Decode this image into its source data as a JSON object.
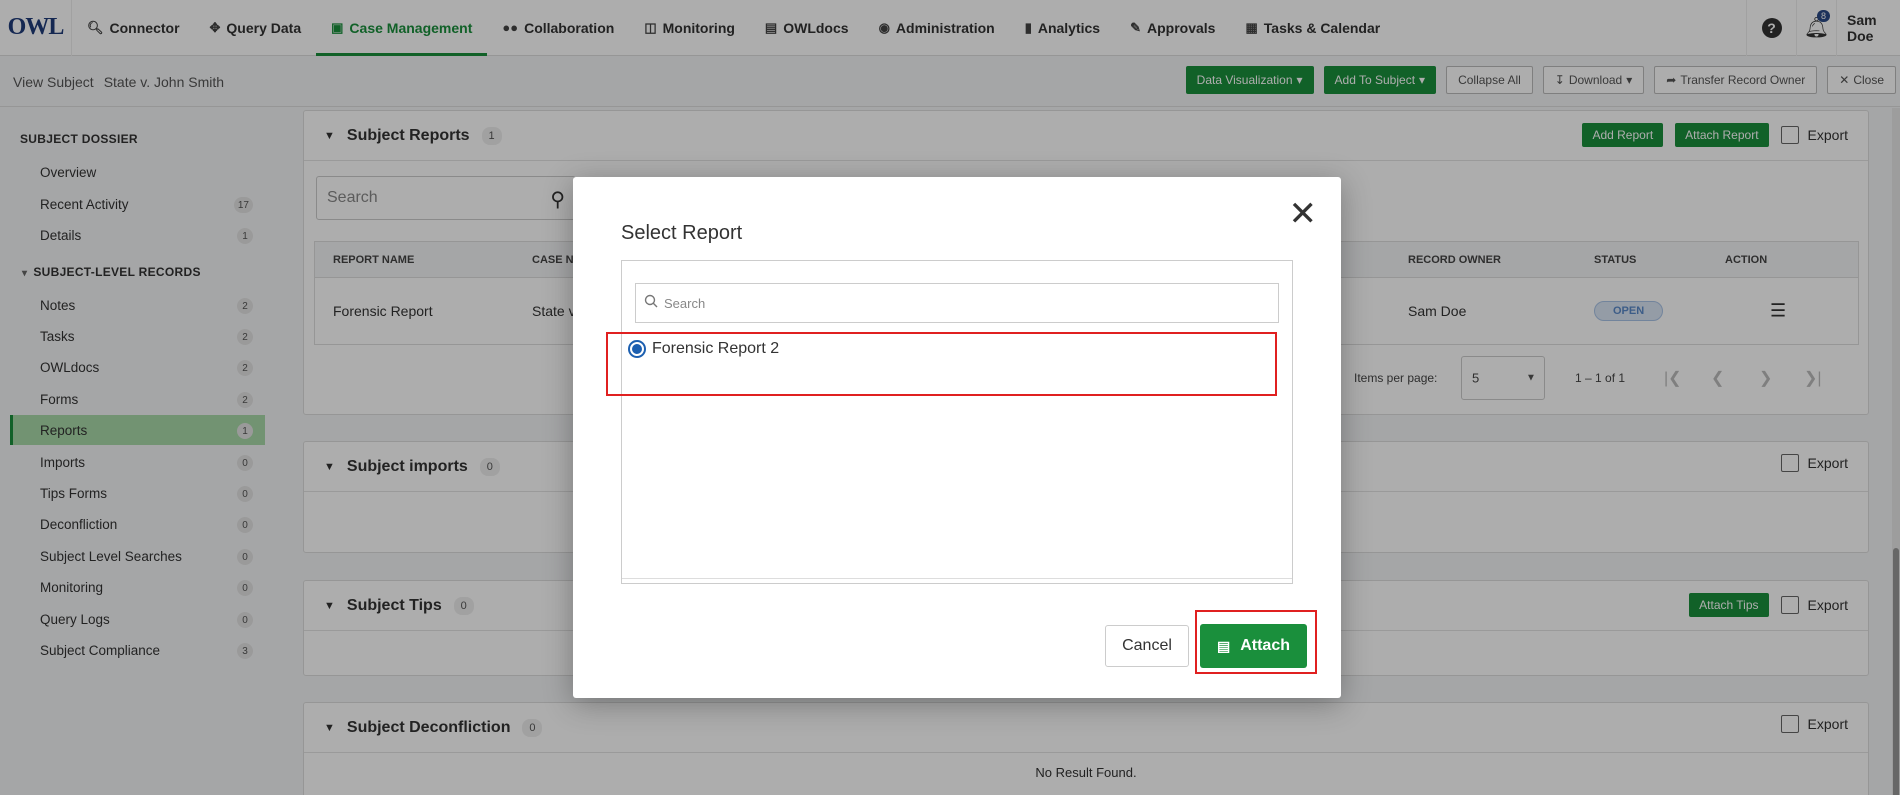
{
  "logo": {
    "text": "OWL"
  },
  "nav": {
    "items": [
      {
        "label": "Connector",
        "icon": "search-icon"
      },
      {
        "label": "Query Data",
        "icon": "move-icon"
      },
      {
        "label": "Case Management",
        "icon": "briefcase-icon",
        "active": true
      },
      {
        "label": "Collaboration",
        "icon": "users-icon"
      },
      {
        "label": "Monitoring",
        "icon": "monitor-icon"
      },
      {
        "label": "OWLdocs",
        "icon": "docs-icon"
      },
      {
        "label": "Administration",
        "icon": "admin-icon"
      },
      {
        "label": "Analytics",
        "icon": "chart-icon"
      },
      {
        "label": "Approvals",
        "icon": "approval-icon"
      },
      {
        "label": "Tasks & Calendar",
        "icon": "calendar-icon"
      }
    ],
    "notifications": "8",
    "user": "Sam Doe"
  },
  "subheader": {
    "label": "View Subject",
    "subject": "State v. John Smith",
    "actions": {
      "data_viz": "Data Visualization",
      "add_to_subject": "Add To Subject",
      "collapse_all": "Collapse All",
      "download": "Download",
      "transfer": "Transfer Record Owner",
      "close": "Close"
    }
  },
  "sidebar": {
    "heading": "SUBJECT DOSSIER",
    "top_items": [
      {
        "label": "Overview",
        "count": null
      },
      {
        "label": "Recent Activity",
        "count": "17"
      },
      {
        "label": "Details",
        "count": "1"
      }
    ],
    "section": "SUBJECT-LEVEL RECORDS",
    "items": [
      {
        "label": "Notes",
        "count": "2"
      },
      {
        "label": "Tasks",
        "count": "2"
      },
      {
        "label": "OWLdocs",
        "count": "2"
      },
      {
        "label": "Forms",
        "count": "2"
      },
      {
        "label": "Reports",
        "count": "1",
        "active": true
      },
      {
        "label": "Imports",
        "count": "0"
      },
      {
        "label": "Tips Forms",
        "count": "0"
      },
      {
        "label": "Deconfliction",
        "count": "0"
      },
      {
        "label": "Subject Level Searches",
        "count": "0"
      },
      {
        "label": "Monitoring",
        "count": "0"
      },
      {
        "label": "Query Logs",
        "count": "0"
      },
      {
        "label": "Subject Compliance",
        "count": "3"
      }
    ]
  },
  "reports_panel": {
    "title": "Subject Reports",
    "count": "1",
    "add_btn": "Add Report",
    "attach_btn": "Attach Report",
    "export": "Export",
    "search_placeholder": "Search",
    "columns": {
      "name": "REPORT NAME",
      "case": "CASE N",
      "owner": "RECORD OWNER",
      "status": "STATUS",
      "action": "ACTION"
    },
    "rows": [
      {
        "name": "Forensic Report",
        "case": "State v",
        "owner": "Sam Doe",
        "status": "OPEN"
      }
    ],
    "pager": {
      "ipp_label": "Items per page:",
      "ipp": "5",
      "range": "1 – 1 of 1"
    }
  },
  "imports_panel": {
    "title": "Subject imports",
    "count": "0",
    "export": "Export"
  },
  "tips_panel": {
    "title": "Subject Tips",
    "count": "0",
    "attach_btn": "Attach Tips",
    "export": "Export"
  },
  "decon_panel": {
    "title": "Subject Deconfliction",
    "count": "0",
    "export": "Export",
    "empty": "No Result Found."
  },
  "modal": {
    "title": "Select Report",
    "search_placeholder": "Search",
    "options": [
      {
        "label": "Forensic Report 2",
        "selected": true
      }
    ],
    "cancel": "Cancel",
    "attach": "Attach"
  }
}
